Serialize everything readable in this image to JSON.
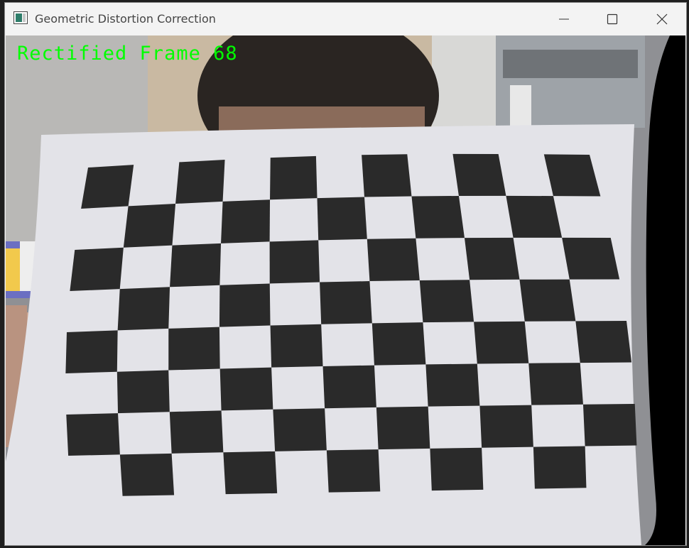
{
  "window": {
    "title": "Geometric Distortion Correction",
    "controls": [
      "minimize",
      "maximize",
      "close"
    ]
  },
  "icons": {
    "app": "image-window-icon",
    "minimize": "minimize-icon",
    "maximize": "maximize-icon",
    "close": "close-icon"
  },
  "frame": {
    "overlay_text": "Rectified Frame 68",
    "overlay_color": "#00ff00",
    "checkerboard_rows": 8,
    "checkerboard_cols": 11
  },
  "colors": {
    "square_dark": "#2a2a2a",
    "paper": "#e3e3e8"
  }
}
